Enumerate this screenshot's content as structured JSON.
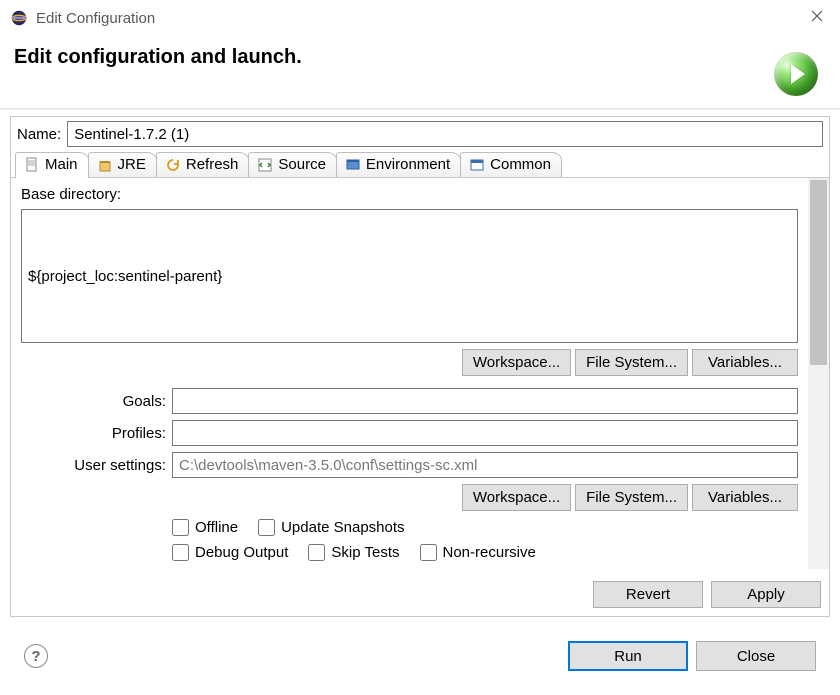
{
  "titlebar": {
    "title": "Edit Configuration"
  },
  "header": {
    "heading": "Edit configuration and launch."
  },
  "name": {
    "label": "Name:",
    "value": "Sentinel-1.7.2 (1)"
  },
  "tabs": {
    "main": "Main",
    "jre": "JRE",
    "refresh": "Refresh",
    "source": "Source",
    "environment": "Environment",
    "common": "Common"
  },
  "main": {
    "base_dir_label": "Base directory:",
    "base_dir_value": "${project_loc:sentinel-parent}",
    "btn_workspace": "Workspace...",
    "btn_filesystem": "File System...",
    "btn_variables": "Variables...",
    "goals_label": "Goals:",
    "goals_value": "",
    "profiles_label": "Profiles:",
    "profiles_value": "",
    "usersettings_label": "User settings:",
    "usersettings_value": "C:\\devtools\\maven-3.5.0\\conf\\settings-sc.xml",
    "chk_offline": "Offline",
    "chk_update": "Update Snapshots",
    "chk_debug": "Debug Output",
    "chk_skip": "Skip Tests",
    "chk_nonrec": "Non-recursive"
  },
  "footer": {
    "revert": "Revert",
    "apply": "Apply",
    "run": "Run",
    "close": "Close"
  }
}
